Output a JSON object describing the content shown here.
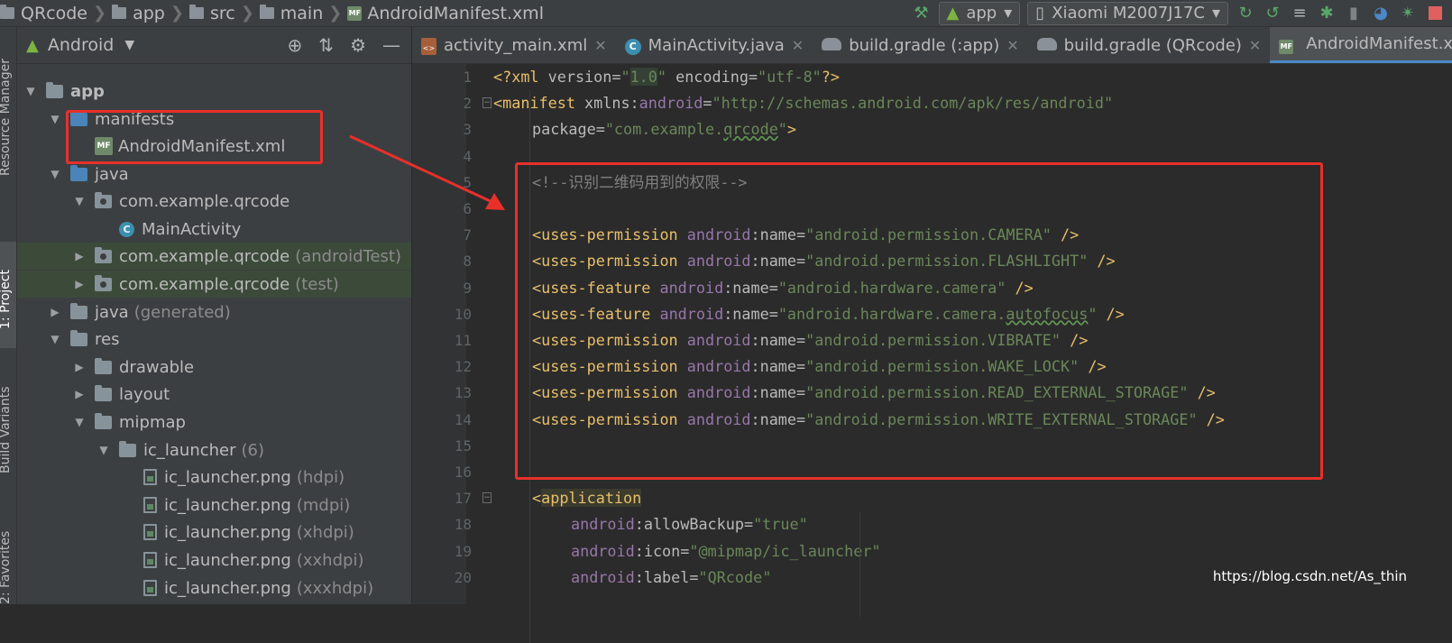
{
  "breadcrumb": {
    "items": [
      "QRcode",
      "app",
      "src",
      "main",
      "AndroidManifest.xml"
    ]
  },
  "toolbar": {
    "config": "app",
    "device": "Xiaomi M2007J17C",
    "icons": [
      "hammer-icon",
      "run-icon",
      "apply-changes-icon",
      "apply-code-changes-icon",
      "debug-icon",
      "attach-debugger-icon",
      "profile-icon",
      "run-tests-icon",
      "stop-icon"
    ]
  },
  "left_strip": {
    "tabs": [
      "Resource Manager",
      "1: Project",
      "Build Variants",
      "2: Favorites"
    ]
  },
  "project_panel": {
    "view": "Android",
    "tree": [
      {
        "indent": 0,
        "arrow": "down",
        "icon": "module",
        "label": "app",
        "muted": "",
        "bold": true
      },
      {
        "indent": 1,
        "arrow": "down",
        "icon": "folder-blue",
        "label": "manifests",
        "muted": ""
      },
      {
        "indent": 2,
        "arrow": "",
        "icon": "mf",
        "label": "AndroidManifest.xml",
        "muted": ""
      },
      {
        "indent": 1,
        "arrow": "down",
        "icon": "folder-blue",
        "label": "java",
        "muted": ""
      },
      {
        "indent": 2,
        "arrow": "down",
        "icon": "pkg",
        "label": "com.example.qrcode",
        "muted": ""
      },
      {
        "indent": 3,
        "arrow": "",
        "icon": "class",
        "label": "MainActivity",
        "muted": ""
      },
      {
        "indent": 2,
        "arrow": "right",
        "icon": "pkg",
        "label": "com.example.qrcode",
        "muted": "(androidTest)",
        "hl": true
      },
      {
        "indent": 2,
        "arrow": "right",
        "icon": "pkg",
        "label": "com.example.qrcode",
        "muted": "(test)",
        "hl": true
      },
      {
        "indent": 1,
        "arrow": "right",
        "icon": "folder-gen",
        "label": "java",
        "muted": "(generated)"
      },
      {
        "indent": 1,
        "arrow": "down",
        "icon": "folder-res",
        "label": "res",
        "muted": ""
      },
      {
        "indent": 2,
        "arrow": "right",
        "icon": "folder",
        "label": "drawable",
        "muted": ""
      },
      {
        "indent": 2,
        "arrow": "right",
        "icon": "folder",
        "label": "layout",
        "muted": ""
      },
      {
        "indent": 2,
        "arrow": "down",
        "icon": "folder",
        "label": "mipmap",
        "muted": ""
      },
      {
        "indent": 3,
        "arrow": "down",
        "icon": "folder",
        "label": "ic_launcher",
        "muted": "(6)"
      },
      {
        "indent": 4,
        "arrow": "",
        "icon": "png",
        "label": "ic_launcher.png",
        "muted": "(hdpi)"
      },
      {
        "indent": 4,
        "arrow": "",
        "icon": "png",
        "label": "ic_launcher.png",
        "muted": "(mdpi)"
      },
      {
        "indent": 4,
        "arrow": "",
        "icon": "png",
        "label": "ic_launcher.png",
        "muted": "(xhdpi)"
      },
      {
        "indent": 4,
        "arrow": "",
        "icon": "png",
        "label": "ic_launcher.png",
        "muted": "(xxhdpi)"
      },
      {
        "indent": 4,
        "arrow": "",
        "icon": "png",
        "label": "ic_launcher.png",
        "muted": "(xxxhdpi)"
      }
    ]
  },
  "editor_tabs": [
    {
      "label": "activity_main.xml",
      "icon": "xml",
      "active": false
    },
    {
      "label": "MainActivity.java",
      "icon": "java",
      "active": false
    },
    {
      "label": "build.gradle (:app)",
      "icon": "gradle",
      "active": false
    },
    {
      "label": "build.gradle (QRcode)",
      "icon": "gradle",
      "active": false
    },
    {
      "label": "AndroidManifest.xml",
      "icon": "mf",
      "active": true
    }
  ],
  "code_lines": [
    {
      "n": "1",
      "indent": 0,
      "tokens": [
        [
          "punc",
          "<?"
        ],
        [
          "tag",
          "xml"
        ],
        [
          "attr",
          " version="
        ],
        [
          "str",
          "\""
        ],
        [
          "str hlv",
          "1.0"
        ],
        [
          "str",
          "\""
        ],
        [
          "attr",
          " encoding="
        ],
        [
          "str",
          "\"utf-8\""
        ],
        [
          "punc",
          "?>"
        ]
      ]
    },
    {
      "n": "2",
      "indent": 0,
      "tokens": [
        [
          "punc",
          "<"
        ],
        [
          "tag",
          "manifest"
        ],
        [
          "attr",
          " xmlns:"
        ],
        [
          "attrns",
          "android"
        ],
        [
          "attr",
          "="
        ],
        [
          "str",
          "\"http://schemas.android.com/apk/res/android\""
        ]
      ]
    },
    {
      "n": "3",
      "indent": 1,
      "tokens": [
        [
          "attr",
          "package="
        ],
        [
          "str",
          "\"com.example."
        ],
        [
          "str typo",
          "qrcode"
        ],
        [
          "str",
          "\""
        ],
        [
          "punc",
          ">"
        ]
      ]
    },
    {
      "n": "4",
      "indent": 0,
      "tokens": []
    },
    {
      "n": "5",
      "indent": 1,
      "tokens": [
        [
          "cmt",
          "<!--识别二维码用到的权限-->"
        ]
      ]
    },
    {
      "n": "6",
      "indent": 0,
      "tokens": []
    },
    {
      "n": "7",
      "indent": 1,
      "tokens": [
        [
          "punc",
          "<"
        ],
        [
          "tag",
          "uses-permission"
        ],
        [
          "attrns",
          " android"
        ],
        [
          "attr",
          ":name="
        ],
        [
          "str",
          "\"android.permission.CAMERA\""
        ],
        [
          "punc",
          " />"
        ]
      ]
    },
    {
      "n": "8",
      "indent": 1,
      "tokens": [
        [
          "punc",
          "<"
        ],
        [
          "tag",
          "uses-permission"
        ],
        [
          "attrns",
          " android"
        ],
        [
          "attr",
          ":name="
        ],
        [
          "str",
          "\"android.permission.FLASHLIGHT\""
        ],
        [
          "punc",
          " />"
        ]
      ]
    },
    {
      "n": "9",
      "indent": 1,
      "tokens": [
        [
          "punc",
          "<"
        ],
        [
          "tag",
          "uses-feature"
        ],
        [
          "attrns",
          " android"
        ],
        [
          "attr",
          ":name="
        ],
        [
          "str",
          "\"android.hardware.camera\""
        ],
        [
          "punc",
          " />"
        ]
      ]
    },
    {
      "n": "10",
      "indent": 1,
      "tokens": [
        [
          "punc",
          "<"
        ],
        [
          "tag",
          "uses-feature"
        ],
        [
          "attrns",
          " android"
        ],
        [
          "attr",
          ":name="
        ],
        [
          "str",
          "\"android.hardware.camera."
        ],
        [
          "str typo",
          "autofocus"
        ],
        [
          "str",
          "\""
        ],
        [
          "punc",
          " />"
        ]
      ]
    },
    {
      "n": "11",
      "indent": 1,
      "tokens": [
        [
          "punc",
          "<"
        ],
        [
          "tag",
          "uses-permission"
        ],
        [
          "attrns",
          " android"
        ],
        [
          "attr",
          ":name="
        ],
        [
          "str",
          "\"android.permission.VIBRATE\""
        ],
        [
          "punc",
          " />"
        ]
      ]
    },
    {
      "n": "12",
      "indent": 1,
      "tokens": [
        [
          "punc",
          "<"
        ],
        [
          "tag",
          "uses-permission"
        ],
        [
          "attrns",
          " android"
        ],
        [
          "attr",
          ":name="
        ],
        [
          "str",
          "\"android.permission.WAKE_LOCK\""
        ],
        [
          "punc",
          " />"
        ]
      ]
    },
    {
      "n": "13",
      "indent": 1,
      "tokens": [
        [
          "punc",
          "<"
        ],
        [
          "tag",
          "uses-permission"
        ],
        [
          "attrns",
          " android"
        ],
        [
          "attr",
          ":name="
        ],
        [
          "str",
          "\"android.permission.READ_EXTERNAL_STORAGE\""
        ],
        [
          "punc",
          " />"
        ]
      ]
    },
    {
      "n": "14",
      "indent": 1,
      "tokens": [
        [
          "punc",
          "<"
        ],
        [
          "tag",
          "uses-permission"
        ],
        [
          "attrns",
          " android"
        ],
        [
          "attr",
          ":name="
        ],
        [
          "str",
          "\"android.permission.WRITE_EXTERNAL_STORAGE\""
        ],
        [
          "punc",
          " />"
        ]
      ]
    },
    {
      "n": "15",
      "indent": 0,
      "tokens": []
    },
    {
      "n": "16",
      "indent": 0,
      "tokens": []
    },
    {
      "n": "17",
      "indent": 1,
      "tokens": [
        [
          "punc",
          "<"
        ],
        [
          "tag apptag",
          "application"
        ]
      ]
    },
    {
      "n": "18",
      "indent": 2,
      "tokens": [
        [
          "attrns",
          "android"
        ],
        [
          "attr",
          ":allowBackup="
        ],
        [
          "str",
          "\"true\""
        ]
      ]
    },
    {
      "n": "19",
      "indent": 2,
      "tokens": [
        [
          "attrns",
          "android"
        ],
        [
          "attr",
          ":icon="
        ],
        [
          "str",
          "\"@mipmap/ic_launcher\""
        ]
      ]
    },
    {
      "n": "20",
      "indent": 2,
      "tokens": [
        [
          "attrns",
          "android"
        ],
        [
          "attr",
          ":label="
        ],
        [
          "str",
          "\"QRcode\""
        ]
      ]
    }
  ],
  "watermark": "https://blog.csdn.net/As_thin",
  "colors": {
    "annotation": "#e8302a",
    "editor_bg": "#2b2b2b",
    "panel_bg": "#3c3f41"
  }
}
